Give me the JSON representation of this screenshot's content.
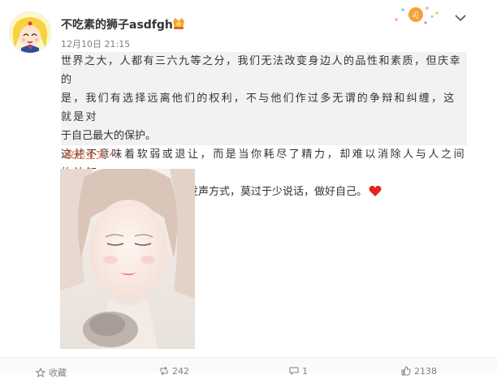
{
  "post": {
    "username": "不吃素的狮子asdfgh",
    "timestamp": "12月10日 21:15",
    "paragraph1": {
      "line1": "世界之大，人都有三六九等之分，我们无法改变身边人的品性和素质，但庆幸的",
      "line2": "是，我们有选择远离他们的权利，不与他们作过多无谓的争辩和纠缠，这就是对",
      "line3": "于自己最大的保护。"
    },
    "paragraph2": {
      "line1": "这并不意味着软弱或退让，而是当你耗尽了精力，却难以消除人与人之间的认知",
      "line2": "差距。你终会明白，最好的发声方式，莫过于少说话，做好自己。"
    },
    "collapse_label": "收起全文",
    "photo_alt": "",
    "colors": {
      "link": "#eb7350",
      "meta": "#808080",
      "text": "#333333",
      "highlight_bg": "#f2f2f2"
    },
    "icons": {
      "dropdown": "chevron-down-icon",
      "vip": "vip-badge-icon",
      "heart": "heart-icon",
      "collapse": "arrow-up-icon"
    },
    "footer": {
      "favorite_label": "收藏",
      "repost_count": "242",
      "comment_count": "1",
      "like_count": "2138"
    }
  }
}
